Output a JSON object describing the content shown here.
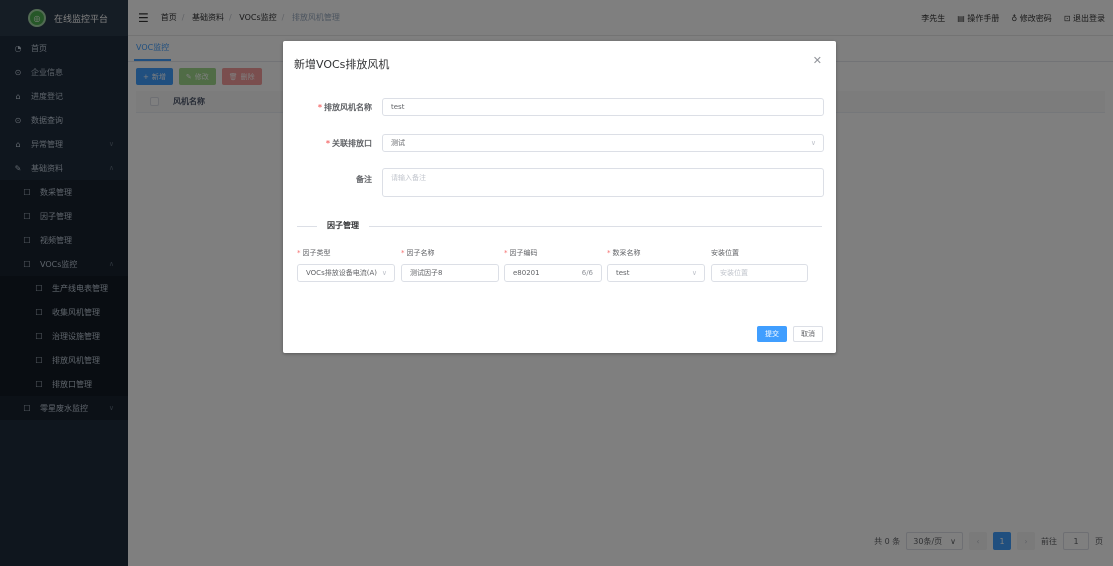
{
  "sidebar": {
    "brand": "在线监控平台",
    "items": [
      {
        "label": "首页",
        "icon": "dashboard-icon"
      },
      {
        "label": "企业信息",
        "icon": "circle-icon"
      },
      {
        "label": "进度登记",
        "icon": "bank-icon"
      },
      {
        "label": "数据查询",
        "icon": "circle-icon"
      },
      {
        "label": "异常管理",
        "icon": "bank-icon"
      },
      {
        "label": "基础资料",
        "icon": "edit-icon"
      }
    ],
    "sub": [
      {
        "label": "数采管理"
      },
      {
        "label": "因子管理"
      },
      {
        "label": "视频管理"
      },
      {
        "label": "VOCs监控"
      }
    ],
    "sub2": [
      {
        "label": "生产线电表管理"
      },
      {
        "label": "收集风机管理"
      },
      {
        "label": "治理设施管理"
      },
      {
        "label": "排放风机管理"
      },
      {
        "label": "排放口管理"
      }
    ],
    "last": {
      "label": "零星废水监控"
    }
  },
  "header": {
    "breadcrumb": [
      "首页",
      "基础资料",
      "VOCs监控",
      "排放风机管理"
    ],
    "user": "李先生",
    "manual": "操作手册",
    "change_password": "修改密码",
    "logout": "退出登录"
  },
  "main": {
    "tab": "VOC监控",
    "toolbar": {
      "add": "新增",
      "edit": "修改",
      "delete": "删除"
    },
    "table": {
      "columns": [
        "风机名称"
      ]
    },
    "pager": {
      "total": "共 0 条",
      "page_size": "30条/页",
      "current": "1",
      "goto": "前往",
      "goto_value": "1",
      "page_unit": "页"
    }
  },
  "dialog": {
    "title": "新增VOCs排放风机",
    "fields": {
      "fan_name": {
        "label": "排放风机名称",
        "value": "test"
      },
      "outlet": {
        "label": "关联排放口",
        "value": "测试"
      },
      "remark": {
        "label": "备注",
        "placeholder": "请输入备注"
      }
    },
    "factor_section": "因子管理",
    "factor_columns": [
      "因子类型",
      "因子名称",
      "因子编码",
      "数采名称",
      "安装位置"
    ],
    "factor_row": {
      "type": "VOCs排放设备电流(A)",
      "name": "测试因子8",
      "code": "e80201",
      "code_count": "6/6",
      "collector": "test",
      "location_placeholder": "安装位置"
    },
    "submit": "提交",
    "cancel": "取消"
  },
  "colors": {
    "accent": "#409eff",
    "sidebar": "#1f2d3d",
    "required": "#f56c6c"
  }
}
